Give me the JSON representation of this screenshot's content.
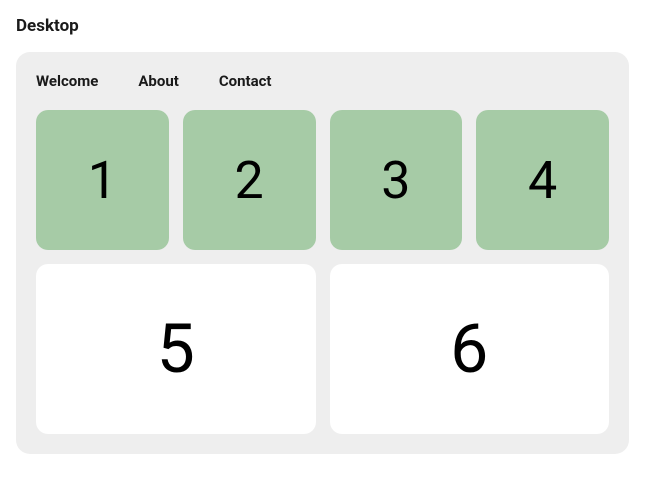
{
  "heading": "Desktop",
  "nav": {
    "items": [
      {
        "label": "Welcome"
      },
      {
        "label": "About"
      },
      {
        "label": "Contact"
      }
    ]
  },
  "tiles": {
    "green": [
      {
        "label": "1"
      },
      {
        "label": "2"
      },
      {
        "label": "3"
      },
      {
        "label": "4"
      }
    ],
    "white": [
      {
        "label": "5"
      },
      {
        "label": "6"
      }
    ]
  }
}
